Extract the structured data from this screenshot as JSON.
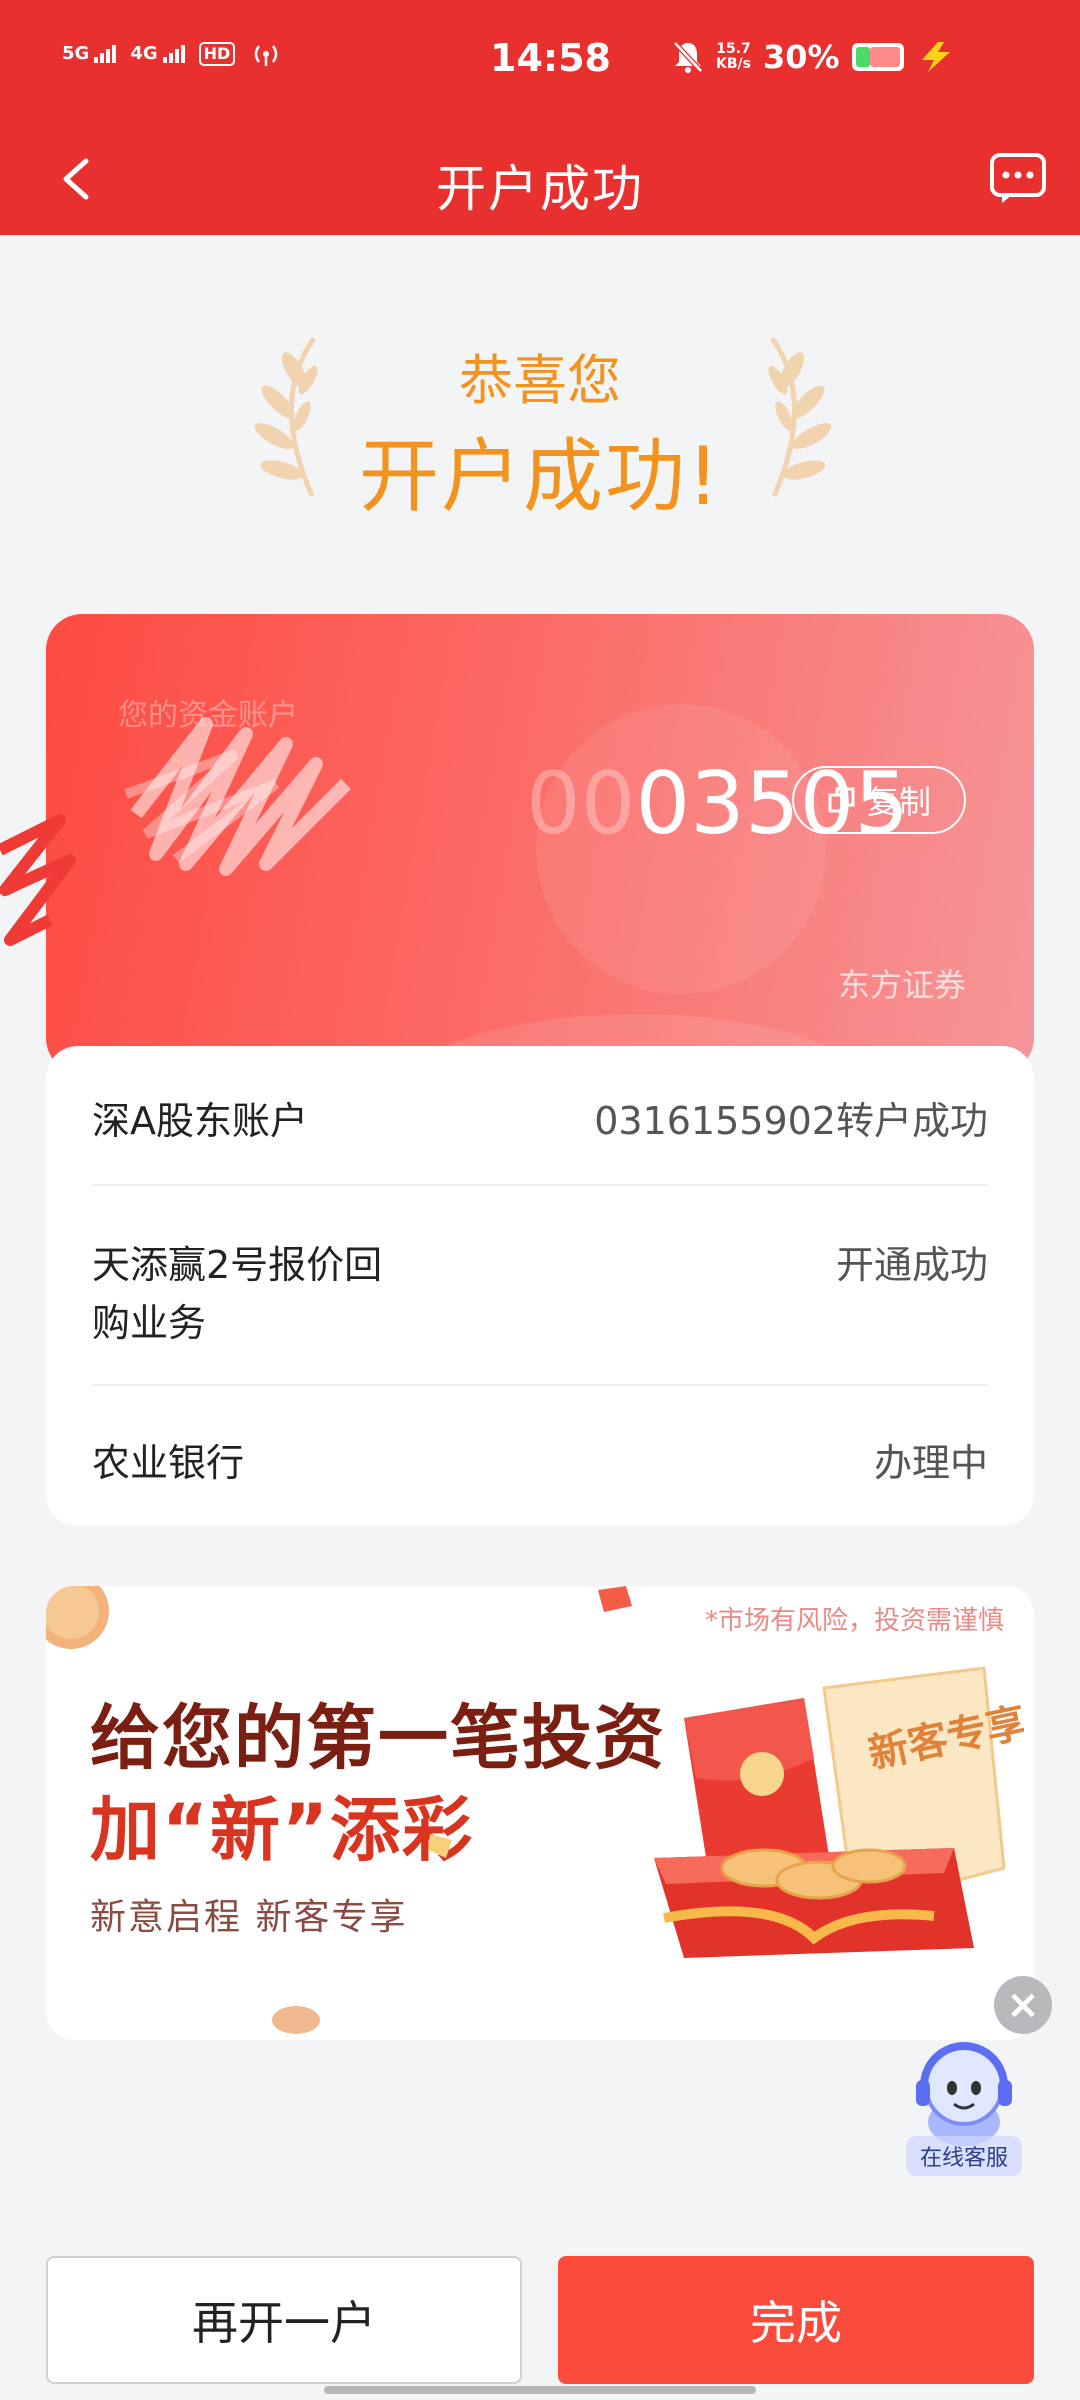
{
  "status_bar": {
    "net1": "5G",
    "net2": "4G",
    "hd": "HD",
    "time": "14:58",
    "speed_value": "15.7",
    "speed_unit": "KB/s",
    "battery_pct": "30%",
    "battery_level": 0.3
  },
  "nav": {
    "title": "开户成功"
  },
  "hero": {
    "congrats": "恭喜您",
    "success": "开户成功!"
  },
  "account_card": {
    "label": "您的资金账户",
    "number_faded": "00",
    "number": "03505",
    "copy_label": "复制",
    "broker": "东方证券"
  },
  "info_rows": [
    {
      "label": "深A股东账户",
      "value": "0316155902转户成功"
    },
    {
      "label_line1": "天添赢2号报价回",
      "label_line2": "购业务",
      "value": "开通成功"
    },
    {
      "label": "农业银行",
      "value": "办理中"
    }
  ],
  "banner": {
    "risk": "*市场有风险，投资需谨慎",
    "title1": "给您的第一笔投资",
    "title2": "加“新”添彩",
    "subtitle": "新意启程  新客专享",
    "envelope_text": "新客专享"
  },
  "service": {
    "label": "在线客服"
  },
  "buttons": {
    "again": "再开一户",
    "done": "完成"
  },
  "colors": {
    "primary_red": "#e8302f",
    "accent_orange": "#f3921c",
    "done_button": "#fb4b3c"
  }
}
